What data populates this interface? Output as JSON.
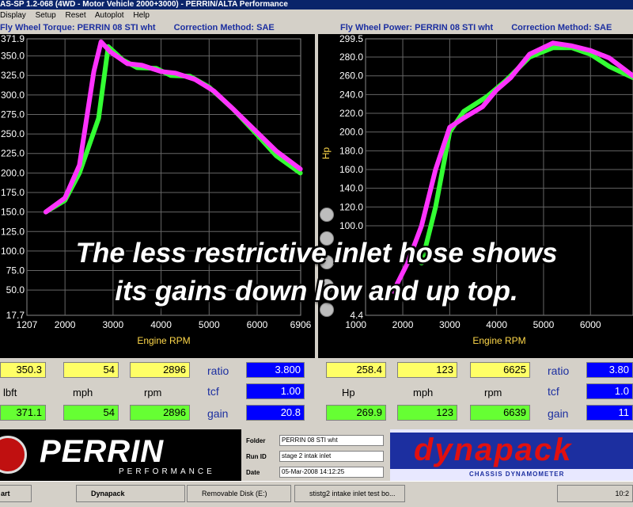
{
  "window": {
    "title": "AS-SP 1.2-068  (4WD - Motor Vehicle 2000+3000) - PERRIN/ALTA Performance"
  },
  "menu": [
    "Display",
    "Setup",
    "Reset",
    "Autoplot",
    "Help"
  ],
  "left_chart_header": {
    "title": "Fly Wheel Torque: PERRIN 08 STI wht",
    "correction": "Correction Method: SAE"
  },
  "right_chart_header": {
    "title": "Fly Wheel Power: PERRIN 08 STI wht",
    "correction": "Correction Method: SAE"
  },
  "chart_data": [
    {
      "type": "line",
      "title": "Fly Wheel Torque: PERRIN 08 STI wht",
      "xlabel": "Engine RPM",
      "ylabel": "",
      "xlim": [
        1207,
        6906
      ],
      "ylim": [
        17.7,
        371.9
      ],
      "x_ticks": [
        "1207",
        "2000",
        "3000",
        "4000",
        "5000",
        "6000",
        "6906"
      ],
      "y_ticks": [
        "371.9",
        "350.0",
        "325.0",
        "300.0",
        "275.0",
        "250.0",
        "225.0",
        "200.0",
        "175.0",
        "150.0",
        "125.0",
        "100.0",
        "75.0",
        "50.0",
        "17.7"
      ],
      "series": [
        {
          "color": "#33ff33",
          "x": [
            1600,
            2000,
            2300,
            2700,
            2900,
            3200,
            3500,
            3900,
            4200,
            4600,
            5000,
            5500,
            6000,
            6400,
            6900
          ],
          "y": [
            150,
            165,
            200,
            270,
            362,
            345,
            335,
            334,
            325,
            324,
            310,
            282,
            249,
            222,
            200
          ]
        },
        {
          "color": "#ff33ff",
          "x": [
            1600,
            2000,
            2300,
            2600,
            2750,
            2950,
            3300,
            3600,
            4000,
            4300,
            4700,
            5100,
            5500,
            6000,
            6400,
            6900
          ],
          "y": [
            150,
            168,
            210,
            330,
            368,
            355,
            340,
            338,
            330,
            328,
            320,
            305,
            282,
            252,
            228,
            205
          ]
        }
      ]
    },
    {
      "type": "line",
      "title": "Fly Wheel Power: PERRIN 08 STI wht",
      "xlabel": "Engine RPM",
      "ylabel": "Hp",
      "xlim": [
        1207,
        6906
      ],
      "ylim": [
        4.4,
        299.5
      ],
      "x_ticks": [
        "1000",
        "2000",
        "3000",
        "4000",
        "5000",
        "6000"
      ],
      "y_ticks": [
        "299.5",
        "280.0",
        "260.0",
        "240.0",
        "220.0",
        "200.0",
        "180.0",
        "160.0",
        "140.0",
        "120.0",
        "100.0",
        "4.4"
      ],
      "series": [
        {
          "color": "#33ff33",
          "x": [
            2400,
            2700,
            3000,
            3300,
            3800,
            4200,
            4700,
            5200,
            5600,
            6000,
            6400,
            6906
          ],
          "y": [
            60,
            120,
            200,
            222,
            238,
            255,
            280,
            290,
            290,
            283,
            270,
            258
          ]
        },
        {
          "color": "#ff33ff",
          "x": [
            1800,
            2100,
            2400,
            2700,
            3000,
            3300,
            3700,
            4000,
            4300,
            4700,
            5200,
            5600,
            6000,
            6400,
            6906
          ],
          "y": [
            30,
            60,
            100,
            160,
            205,
            215,
            227,
            245,
            258,
            283,
            295,
            292,
            287,
            279,
            260
          ]
        }
      ]
    }
  ],
  "readouts_left": {
    "row1": [
      "350.3",
      "54",
      "2896"
    ],
    "units": [
      "lbft",
      "mph",
      "rpm"
    ],
    "row2": [
      "371.1",
      "54",
      "2896"
    ]
  },
  "readouts_mid": {
    "labels": [
      "ratio",
      "tcf",
      "gain"
    ],
    "values": [
      "3.800",
      "1.00",
      "20.8"
    ]
  },
  "readouts_right": {
    "row1": [
      "258.4",
      "123",
      "6625"
    ],
    "units": [
      "Hp",
      "mph",
      "rpm"
    ],
    "row2": [
      "269.9",
      "123",
      "6639"
    ]
  },
  "readouts_far": {
    "labels": [
      "ratio",
      "tcf",
      "gain"
    ],
    "values": [
      "3.80",
      "1.0",
      "11"
    ]
  },
  "info": {
    "folder_label": "Folder",
    "folder": "PERRIN 08 STI wht",
    "run_label": "Run ID",
    "run": "stage 2 intak inlet",
    "date_label": "Date",
    "date": "05-Mar-2008  14:12:25"
  },
  "branding": {
    "perrin": "PERRIN",
    "perrin_sub": "PERFORMANCE",
    "dynapack": "dynapack",
    "dynapack_sub": "CHASSIS   DYNAMOMETER"
  },
  "overlay": {
    "line1": "The less restrictive inlet hose shows",
    "line2": "its gains down low and up top."
  },
  "taskbar": {
    "start": "art",
    "items": [
      "Dynapack",
      "Removable Disk (E:)",
      "stistg2 intake inlet test bo..."
    ],
    "clock": "10:2"
  }
}
